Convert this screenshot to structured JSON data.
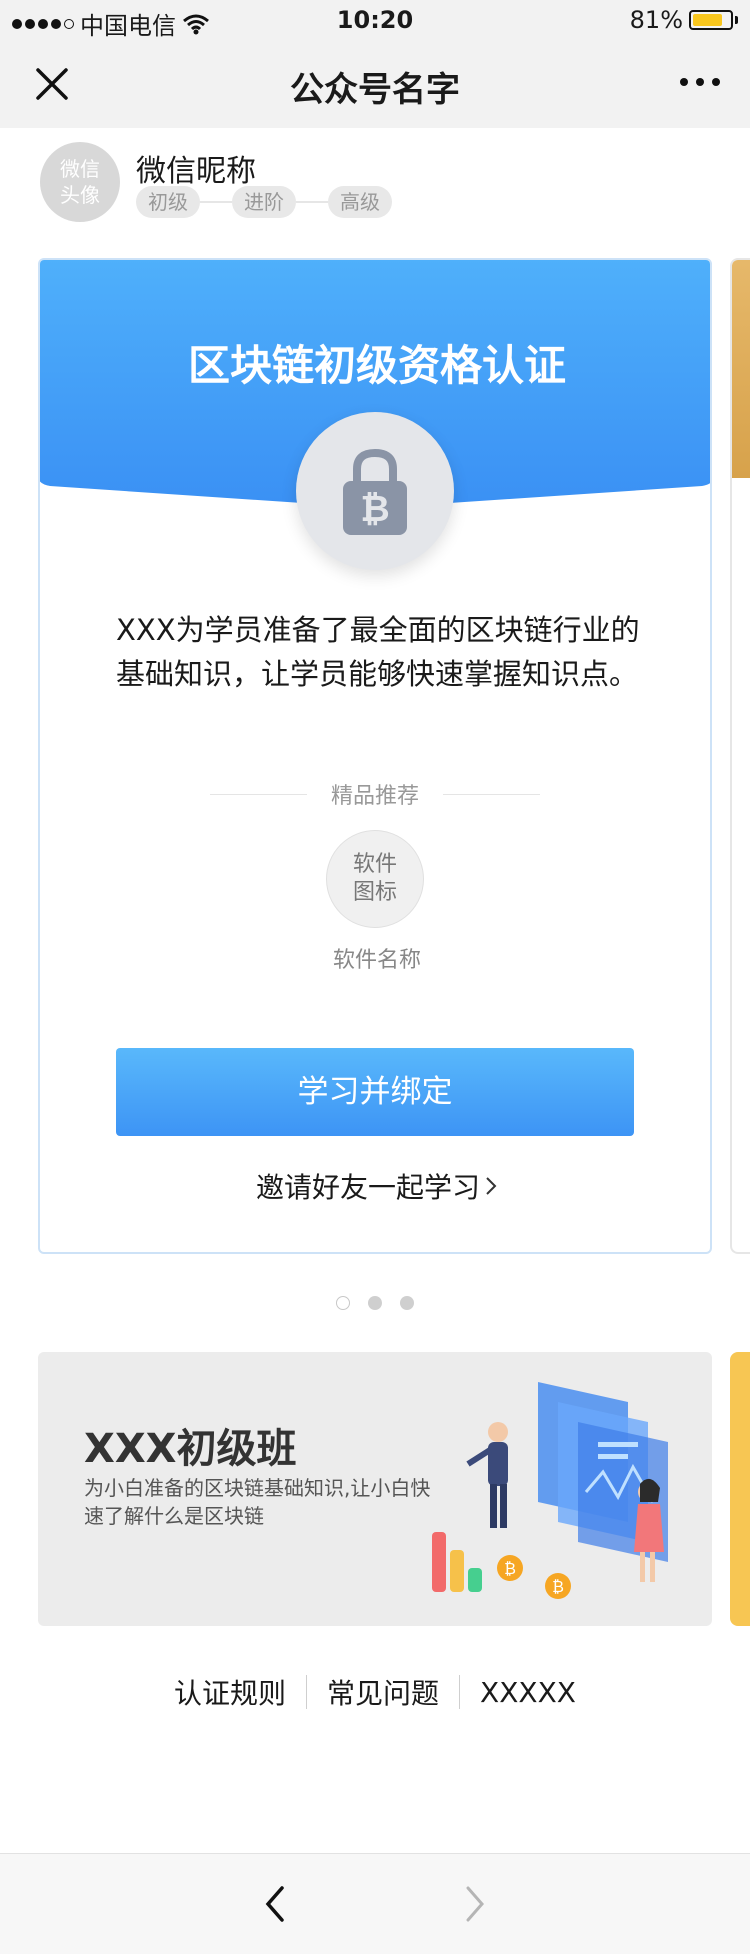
{
  "status_bar": {
    "carrier": "中国电信",
    "time": "10:20",
    "battery": "81%",
    "battery_level": 0.81
  },
  "nav": {
    "title": "公众号名字"
  },
  "profile": {
    "avatar_text": "微信头像",
    "nickname": "微信昵称",
    "levels": [
      "初级",
      "进阶",
      "高级"
    ]
  },
  "card": {
    "title": "区块链初级资格认证",
    "description": "XXX为学员准备了最全面的区块链行业的基础知识，让学员能够快速掌握知识点。",
    "recommend_label": "精品推荐",
    "app_icon_text": "软件图标",
    "app_name": "软件名称",
    "primary_button": "学习并绑定",
    "invite_link": "邀请好友一起学习",
    "colors": {
      "header_top": "#4fb0fb",
      "header_bottom": "#3a90f4"
    }
  },
  "pager": {
    "count": 3,
    "active": 0
  },
  "banner": {
    "title": "XXX初级班",
    "description": "为小白准备的区块链基础知识,让小白快速了解什么是区块链"
  },
  "footer_links": [
    "认证规则",
    "常见问题",
    "XXXXX"
  ],
  "icons": [
    "close-icon",
    "more-icon",
    "lock-bitcoin-icon",
    "chevron-right-icon",
    "back-arrow-icon",
    "forward-arrow-icon",
    "wifi-icon",
    "battery-icon"
  ]
}
